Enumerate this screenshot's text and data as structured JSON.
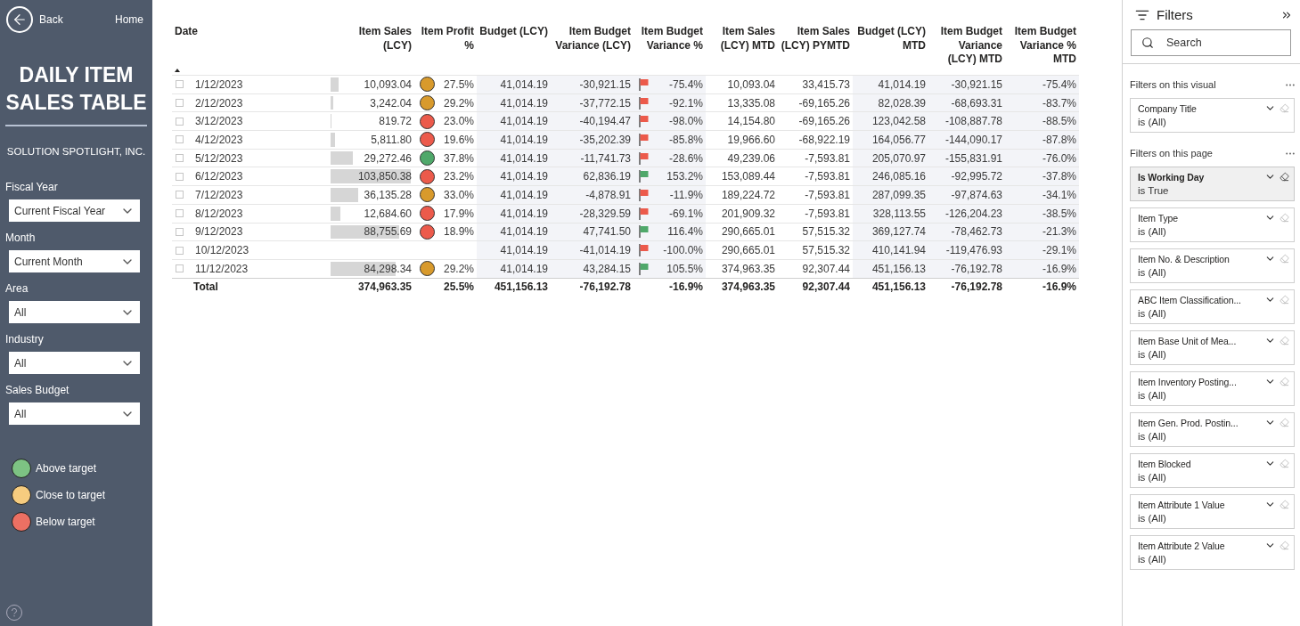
{
  "nav": {
    "back": "Back",
    "home": "Home"
  },
  "title": "DAILY ITEM SALES TABLE",
  "company": "SOLUTION SPOTLIGHT, INC.",
  "slicers": [
    {
      "label": "Fiscal Year",
      "value": "Current Fiscal Year"
    },
    {
      "label": "Month",
      "value": "Current Month"
    },
    {
      "label": "Area",
      "value": "All"
    },
    {
      "label": "Industry",
      "value": "All"
    },
    {
      "label": "Sales Budget",
      "value": "All"
    }
  ],
  "legend": [
    {
      "label": "Above target",
      "color": "#7dc383"
    },
    {
      "label": "Close to target",
      "color": "#f6cc7f"
    },
    {
      "label": "Below target",
      "color": "#ec7063"
    }
  ],
  "table": {
    "columns": [
      "Date",
      "Item Sales (LCY)",
      "Item Profit %",
      "Budget (LCY)",
      "Item Budget Variance (LCY)",
      "Item Budget Variance %",
      "Item Sales (LCY) MTD",
      "Item Sales (LCY) PYMTD",
      "Budget (LCY) MTD",
      "Item Budget Variance (LCY) MTD",
      "Item Budget Variance % MTD"
    ],
    "rows": [
      {
        "date": "1/12/2023",
        "sales": {
          "text": "10,093.04",
          "level": 0.097
        },
        "profit": {
          "text": "27.5%",
          "color": "#d89a2c"
        },
        "budget": "41,014.19",
        "variance": "-30,921.15",
        "variance_pct": {
          "text": "-75.4%",
          "color": "#ec5a4b"
        },
        "mtd": "10,093.04",
        "pymtd": "33,415.73",
        "budget_mtd": "41,014.19",
        "variance_mtd": "-30,921.15",
        "variance_pct_mtd": "-75.4%"
      },
      {
        "date": "2/12/2023",
        "sales": {
          "text": "3,242.04",
          "level": 0.031
        },
        "profit": {
          "text": "29.2%",
          "color": "#d89a2c"
        },
        "budget": "41,014.19",
        "variance": "-37,772.15",
        "variance_pct": {
          "text": "-92.1%",
          "color": "#ec5a4b"
        },
        "mtd": "13,335.08",
        "pymtd": "-69,165.26",
        "budget_mtd": "82,028.39",
        "variance_mtd": "-68,693.31",
        "variance_pct_mtd": "-83.7%"
      },
      {
        "date": "3/12/2023",
        "sales": {
          "text": "819.72",
          "level": 0.008
        },
        "profit": {
          "text": "23.0%",
          "color": "#ec5a4b"
        },
        "budget": "41,014.19",
        "variance": "-40,194.47",
        "variance_pct": {
          "text": "-98.0%",
          "color": "#ec5a4b"
        },
        "mtd": "14,154.80",
        "pymtd": "-69,165.26",
        "budget_mtd": "123,042.58",
        "variance_mtd": "-108,887.78",
        "variance_pct_mtd": "-88.5%"
      },
      {
        "date": "4/12/2023",
        "sales": {
          "text": "5,811.80",
          "level": 0.056
        },
        "profit": {
          "text": "19.6%",
          "color": "#ec5a4b"
        },
        "budget": "41,014.19",
        "variance": "-35,202.39",
        "variance_pct": {
          "text": "-85.8%",
          "color": "#ec5a4b"
        },
        "mtd": "19,966.60",
        "pymtd": "-68,922.19",
        "budget_mtd": "164,056.77",
        "variance_mtd": "-144,090.17",
        "variance_pct_mtd": "-87.8%"
      },
      {
        "date": "5/12/2023",
        "sales": {
          "text": "29,272.46",
          "level": 0.282
        },
        "profit": {
          "text": "37.8%",
          "color": "#4fa86a"
        },
        "budget": "41,014.19",
        "variance": "-11,741.73",
        "variance_pct": {
          "text": "-28.6%",
          "color": "#ec5a4b"
        },
        "mtd": "49,239.06",
        "pymtd": "-7,593.81",
        "budget_mtd": "205,070.97",
        "variance_mtd": "-155,831.91",
        "variance_pct_mtd": "-76.0%"
      },
      {
        "date": "6/12/2023",
        "sales": {
          "text": "103,850.38",
          "level": 1
        },
        "profit": {
          "text": "23.2%",
          "color": "#ec5a4b"
        },
        "budget": "41,014.19",
        "variance": "62,836.19",
        "variance_pct": {
          "text": "153.2%",
          "color": "#4fa86a"
        },
        "mtd": "153,089.44",
        "pymtd": "-7,593.81",
        "budget_mtd": "246,085.16",
        "variance_mtd": "-92,995.72",
        "variance_pct_mtd": "-37.8%"
      },
      {
        "date": "7/12/2023",
        "sales": {
          "text": "36,135.28",
          "level": 0.348
        },
        "profit": {
          "text": "33.0%",
          "color": "#d89a2c"
        },
        "budget": "41,014.19",
        "variance": "-4,878.91",
        "variance_pct": {
          "text": "-11.9%",
          "color": "#ec5a4b"
        },
        "mtd": "189,224.72",
        "pymtd": "-7,593.81",
        "budget_mtd": "287,099.35",
        "variance_mtd": "-97,874.63",
        "variance_pct_mtd": "-34.1%"
      },
      {
        "date": "8/12/2023",
        "sales": {
          "text": "12,684.60",
          "level": 0.122
        },
        "profit": {
          "text": "17.9%",
          "color": "#ec5a4b"
        },
        "budget": "41,014.19",
        "variance": "-28,329.59",
        "variance_pct": {
          "text": "-69.1%",
          "color": "#ec5a4b"
        },
        "mtd": "201,909.32",
        "pymtd": "-7,593.81",
        "budget_mtd": "328,113.55",
        "variance_mtd": "-126,204.23",
        "variance_pct_mtd": "-38.5%"
      },
      {
        "date": "9/12/2023",
        "sales": {
          "text": "88,755.69",
          "level": 0.855
        },
        "profit": {
          "text": "18.9%",
          "color": "#ec5a4b"
        },
        "budget": "41,014.19",
        "variance": "47,741.50",
        "variance_pct": {
          "text": "116.4%",
          "color": "#4fa86a"
        },
        "mtd": "290,665.01",
        "pymtd": "57,515.32",
        "budget_mtd": "369,127.74",
        "variance_mtd": "-78,462.73",
        "variance_pct_mtd": "-21.3%"
      },
      {
        "date": "10/12/2023",
        "budget": "41,014.19",
        "variance": "-41,014.19",
        "variance_pct": {
          "text": "-100.0%",
          "color": "#ec5a4b"
        },
        "mtd": "290,665.01",
        "pymtd": "57,515.32",
        "budget_mtd": "410,141.94",
        "variance_mtd": "-119,476.93",
        "variance_pct_mtd": "-29.1%"
      },
      {
        "date": "11/12/2023",
        "sales": {
          "text": "84,298.34",
          "level": 0.812
        },
        "profit": {
          "text": "29.2%",
          "color": "#d89a2c"
        },
        "budget": "41,014.19",
        "variance": "43,284.15",
        "variance_pct": {
          "text": "105.5%",
          "color": "#4fa86a"
        },
        "mtd": "374,963.35",
        "pymtd": "92,307.44",
        "budget_mtd": "451,156.13",
        "variance_mtd": "-76,192.78",
        "variance_pct_mtd": "-16.9%"
      }
    ],
    "total": [
      "Total",
      "374,963.35",
      "25.5%",
      "451,156.13",
      "-76,192.78",
      "-16.9%",
      "374,963.35",
      "92,307.44",
      "451,156.13",
      "-76,192.78",
      "-16.9%"
    ]
  },
  "filters": {
    "title": "Filters",
    "search": {
      "placeholder": "Search"
    },
    "sections": [
      {
        "title": "Filters on this visual",
        "cards": [
          {
            "name": "Company Title",
            "value": "is (All)",
            "selected": false
          }
        ]
      },
      {
        "title": "Filters on this page",
        "cards": [
          {
            "name": "Is Working Day",
            "value": "is True",
            "selected": true
          },
          {
            "name": "Item Type",
            "value": "is (All)",
            "selected": false
          },
          {
            "name": "Item No. & Description",
            "value": "is (All)",
            "selected": false
          },
          {
            "name": "ABC Item Classification...",
            "value": "is (All)",
            "selected": false
          },
          {
            "name": "Item Base Unit of Mea...",
            "value": "is (All)",
            "selected": false
          },
          {
            "name": "Item Inventory Posting...",
            "value": "is (All)",
            "selected": false
          },
          {
            "name": "Item Gen. Prod. Postin...",
            "value": "is (All)",
            "selected": false
          },
          {
            "name": "Item Blocked",
            "value": "is (All)",
            "selected": false
          },
          {
            "name": "Item Attribute 1 Value",
            "value": "is (All)",
            "selected": false
          },
          {
            "name": "Item Attribute 2 Value",
            "value": "is (All)",
            "selected": false
          }
        ]
      }
    ]
  }
}
